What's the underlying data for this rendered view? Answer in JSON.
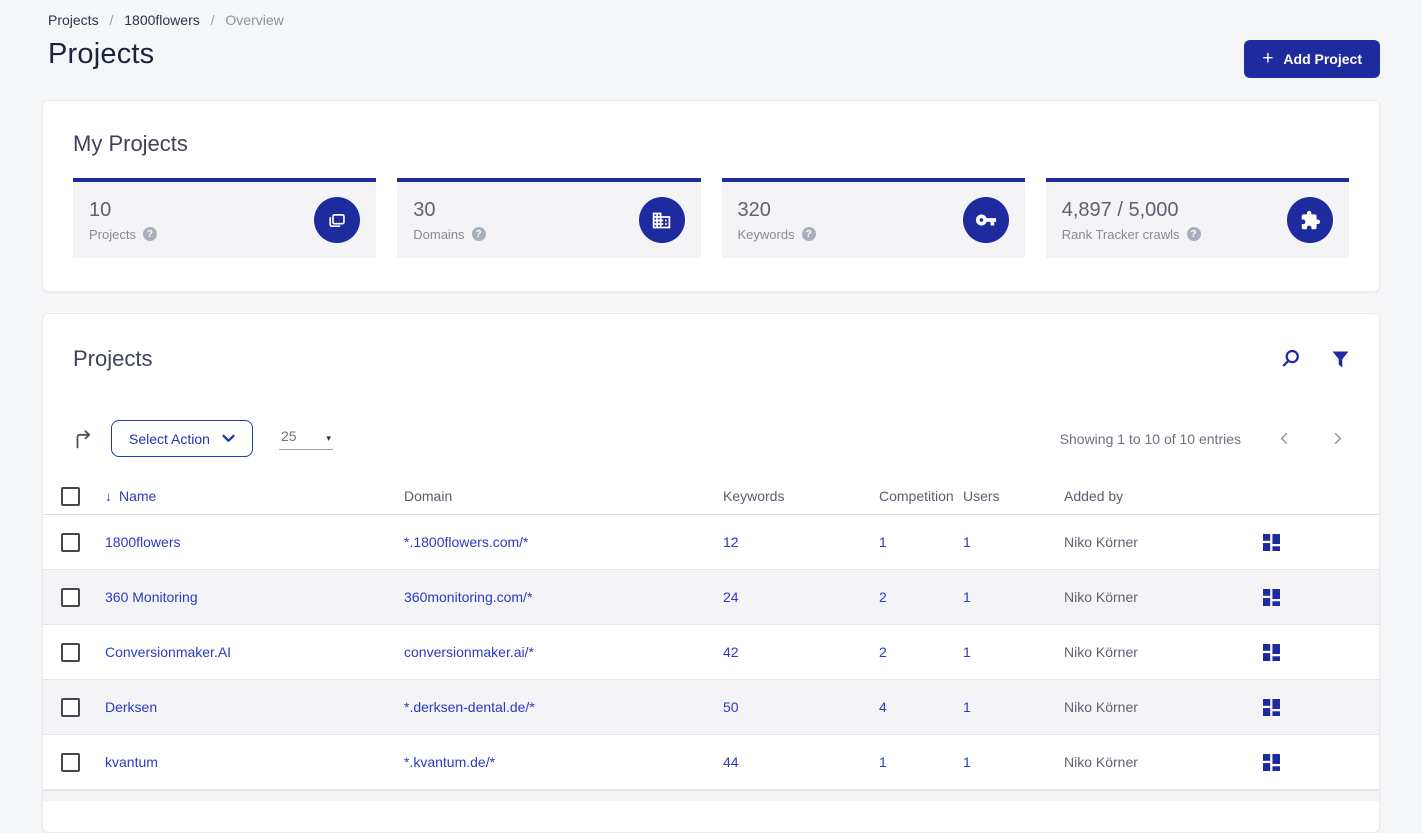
{
  "breadcrumb": {
    "separator": "/",
    "items": [
      {
        "label": "Projects"
      },
      {
        "label": "1800flowers"
      },
      {
        "label": "Overview"
      }
    ]
  },
  "page_title": "Projects",
  "toolbar": {
    "add_project_label": "Add Project"
  },
  "icons": {
    "plus": "+",
    "sort_desc": "↓",
    "caret_down": "▾",
    "help": "?"
  },
  "my_projects": {
    "title": "My Projects",
    "stats": [
      {
        "value": "10",
        "label": "Projects",
        "icon": "copy-icon"
      },
      {
        "value": "30",
        "label": "Domains",
        "icon": "building-icon"
      },
      {
        "value": "320",
        "label": "Keywords",
        "icon": "key-icon"
      },
      {
        "value": "4,897 / 5,000",
        "label": "Rank Tracker crawls",
        "icon": "puzzle-icon"
      }
    ]
  },
  "projects_panel": {
    "title": "Projects",
    "select_action_label": "Select Action",
    "page_size": "25",
    "showing_text": "Showing 1 to 10 of 10 entries",
    "table": {
      "columns": [
        "Name",
        "Domain",
        "Keywords",
        "Competition",
        "Users",
        "Added by"
      ],
      "rows": [
        {
          "name": "1800flowers",
          "domain": "*.1800flowers.com/*",
          "keywords": "12",
          "competition": "1",
          "users": "1",
          "added_by": "Niko Körner"
        },
        {
          "name": "360 Monitoring",
          "domain": "360monitoring.com/*",
          "keywords": "24",
          "competition": "2",
          "users": "1",
          "added_by": "Niko Körner"
        },
        {
          "name": "Conversionmaker.AI",
          "domain": "conversionmaker.ai/*",
          "keywords": "42",
          "competition": "2",
          "users": "1",
          "added_by": "Niko Körner"
        },
        {
          "name": "Derksen",
          "domain": "*.derksen-dental.de/*",
          "keywords": "50",
          "competition": "4",
          "users": "1",
          "added_by": "Niko Körner"
        },
        {
          "name": "kvantum",
          "domain": "*.kvantum.de/*",
          "keywords": "44",
          "competition": "1",
          "users": "1",
          "added_by": "Niko Körner"
        }
      ]
    }
  },
  "colors": {
    "brand_blue": "#1e2b9e",
    "link_blue": "#2a3ac2",
    "page_bg": "#f5f6f8",
    "stripe_bg": "#f4f4f6",
    "title_navy": "#1c2342"
  }
}
